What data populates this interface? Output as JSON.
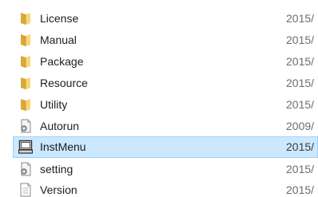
{
  "file_list": {
    "items": [
      {
        "name": "License",
        "date": "2015/",
        "icon": "folder-icon"
      },
      {
        "name": "Manual",
        "date": "2015/",
        "icon": "folder-icon"
      },
      {
        "name": "Package",
        "date": "2015/",
        "icon": "folder-icon"
      },
      {
        "name": "Resource",
        "date": "2015/",
        "icon": "folder-icon"
      },
      {
        "name": "Utility",
        "date": "2015/",
        "icon": "folder-icon"
      },
      {
        "name": "Autorun",
        "date": "2009/",
        "icon": "settings-file-icon"
      },
      {
        "name": "InstMenu",
        "date": "2015/",
        "icon": "application-icon",
        "selected": true
      },
      {
        "name": "setting",
        "date": "2015/",
        "icon": "settings-file-icon"
      },
      {
        "name": "Version",
        "date": "2015/",
        "icon": "text-document-icon"
      }
    ]
  },
  "colors": {
    "selection_background": "#cce8ff",
    "selection_border": "#99d1ff",
    "folder_yellow": "#f8d775",
    "date_text": "#6d6d6d"
  }
}
